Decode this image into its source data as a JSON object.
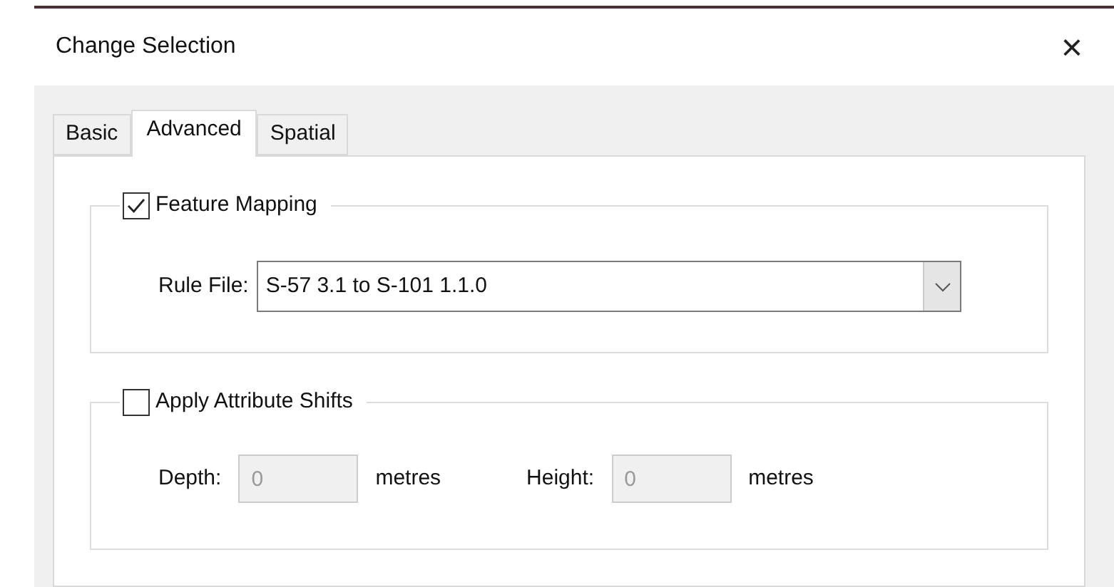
{
  "window": {
    "title": "Change Selection",
    "close": "×"
  },
  "tabs": [
    {
      "label": "Basic",
      "selected": false
    },
    {
      "label": "Advanced",
      "selected": true
    },
    {
      "label": "Spatial",
      "selected": false
    }
  ],
  "feature_mapping": {
    "label": "Feature Mapping",
    "checked": true,
    "rule_file_label": "Rule File:",
    "rule_file_value": "S-57 3.1 to S-101 1.1.0"
  },
  "attribute_shifts": {
    "label": "Apply Attribute Shifts",
    "checked": false,
    "fields": [
      {
        "label": "Depth:",
        "value": "0",
        "unit": "metres",
        "disabled": true
      },
      {
        "label": "Height:",
        "value": "0",
        "unit": "metres",
        "disabled": true
      }
    ]
  }
}
